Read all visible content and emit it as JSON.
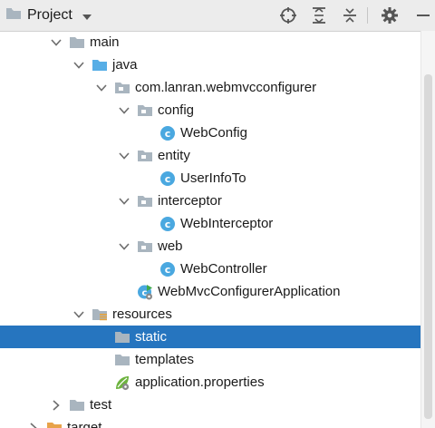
{
  "header": {
    "title": "Project"
  },
  "tree": {
    "main": "main",
    "java": "java",
    "package": "com.lanran.webmvcconfigurer",
    "config": "config",
    "webconfig": "WebConfig",
    "entity": "entity",
    "userinfoto": "UserInfoTo",
    "interceptor": "interceptor",
    "webinterceptor": "WebInterceptor",
    "web": "web",
    "webcontroller": "WebController",
    "application": "WebMvcConfigurerApplication",
    "resources": "resources",
    "static": "static",
    "templates": "templates",
    "properties": "application.properties",
    "test": "test",
    "target": "target"
  },
  "colors": {
    "selection": "#2675bf",
    "folder": "#a9b5bf",
    "source_folder": "#57aee6",
    "class_icon": "#4aa8e0"
  }
}
